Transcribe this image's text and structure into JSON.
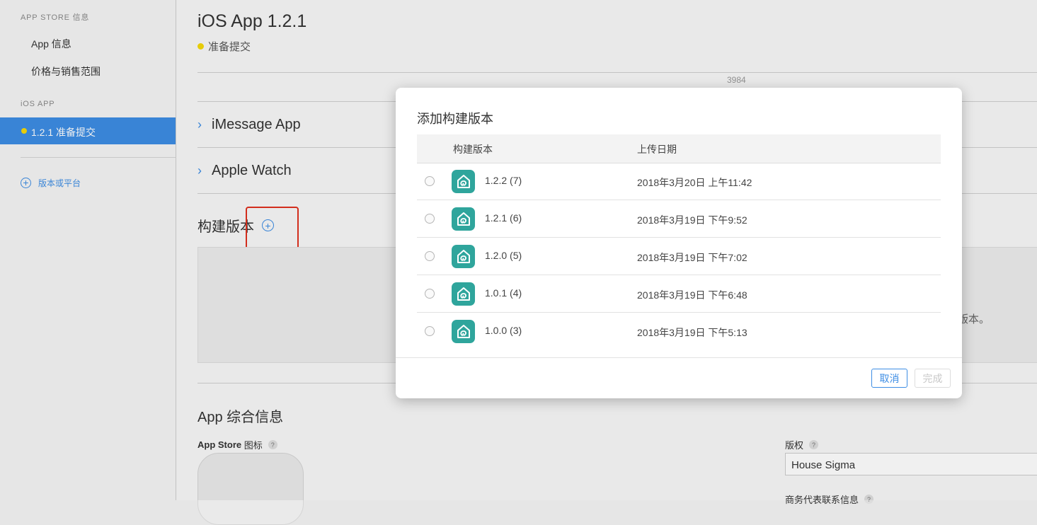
{
  "sidebar": {
    "section1": "APP STORE 信息",
    "items": [
      "App 信息",
      "价格与销售范围"
    ],
    "section2": "iOS APP",
    "active_item": "1.2.1 准备提交",
    "add_label": "版本或平台"
  },
  "main": {
    "title": "iOS App 1.2.1",
    "status": "准备提交",
    "build_number": "3984",
    "imessage": "iMessage App",
    "watch": "Apple Watch",
    "build_section": "构建版本",
    "build_empty_fragment": "版本。",
    "general_section": "App 综合信息",
    "app_store_icon_label": "App Store",
    "app_store_icon_label_suffix": "图标",
    "copyright_label": "版权",
    "copyright_value": "House Sigma",
    "business_contact_label": "商务代表联系信息"
  },
  "modal": {
    "title": "添加构建版本",
    "col_build": "构建版本",
    "col_date": "上传日期",
    "rows": [
      {
        "version": "1.2.2 (7)",
        "date": "2018年3月20日 上午11:42"
      },
      {
        "version": "1.2.1 (6)",
        "date": "2018年3月19日 下午9:52"
      },
      {
        "version": "1.2.0 (5)",
        "date": "2018年3月19日 下午7:02"
      },
      {
        "version": "1.0.1 (4)",
        "date": "2018年3月19日 下午6:48"
      },
      {
        "version": "1.0.0 (3)",
        "date": "2018年3月19日 下午5:13"
      }
    ],
    "cancel": "取消",
    "done": "完成"
  },
  "colors": {
    "accent": "#3d8de4",
    "status_yellow": "#f5d90a",
    "app_icon": "#2fa59c",
    "highlight": "#e0301e"
  },
  "icons": [
    "chevron-right-icon",
    "add-circle-icon",
    "help-icon",
    "app-house-icon"
  ]
}
